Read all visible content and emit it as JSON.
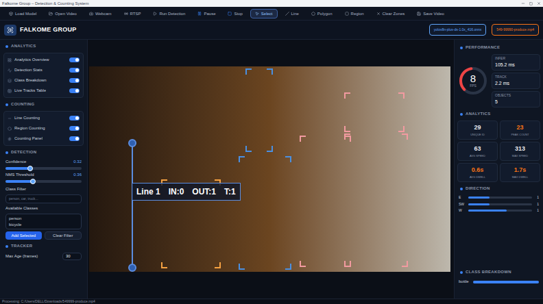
{
  "window": {
    "title": "Falkome Group – Detection & Counting System"
  },
  "toolbar": [
    {
      "label": "Load Model",
      "selected": false
    },
    {
      "label": "Open Video",
      "selected": false
    },
    {
      "label": "Webcam",
      "selected": false
    },
    {
      "label": "RTSP",
      "selected": false
    },
    {
      "label": "Run Detection",
      "selected": false
    },
    {
      "label": "Pause",
      "selected": false
    },
    {
      "label": "Stop",
      "selected": false
    },
    {
      "label": "Select",
      "selected": true
    },
    {
      "label": "Line",
      "selected": false
    },
    {
      "label": "Polygon",
      "selected": false
    },
    {
      "label": "Region",
      "selected": false
    },
    {
      "label": "Clear Zones",
      "selected": false
    },
    {
      "label": "Save Video",
      "selected": false
    }
  ],
  "header": {
    "brand": "FALKOME GROUP",
    "badges": [
      {
        "text": "yolov8n-plus-ds-1.0x_416.onnx",
        "color": "#60a5fa"
      },
      {
        "text": "549-99990-produce.mp4",
        "color": "#f97316"
      }
    ]
  },
  "sidebar": {
    "analytics": {
      "title": "ANALYTICS",
      "toggles": [
        {
          "label": "Analytics Overview",
          "on": true
        },
        {
          "label": "Detection Stats",
          "on": true
        },
        {
          "label": "Class Breakdown",
          "on": true
        },
        {
          "label": "Live Tracks Table",
          "on": true
        }
      ]
    },
    "counting": {
      "title": "COUNTING",
      "toggles": [
        {
          "label": "Line Counting",
          "on": true
        },
        {
          "label": "Region Counting",
          "on": true
        },
        {
          "label": "Counting Panel",
          "on": true
        }
      ]
    },
    "detection": {
      "title": "DETECTION",
      "sliders": [
        {
          "label": "Confidence",
          "value": "0.32",
          "level": 0.32
        },
        {
          "label": "NMS Threshold",
          "value": "0.36",
          "level": 0.36
        }
      ],
      "class_filter": {
        "label": "Class Filter",
        "placeholder": "person, car, truck..."
      },
      "available": {
        "label": "Available Classes",
        "classes": [
          "person",
          "bicycle"
        ]
      },
      "buttons": [
        {
          "label": "Add Selected",
          "primary": true
        },
        {
          "label": "Clear Filter",
          "primary": false
        }
      ]
    },
    "tracker": {
      "title": "TRACKER",
      "field": {
        "label": "Max Age (frames)",
        "value": "30"
      }
    }
  },
  "video": {
    "line": {
      "name": "Line 1",
      "in": "IN:0",
      "out": "OUT:1",
      "total": "T:1"
    },
    "detections": [
      {
        "color": "#4a90e2"
      },
      {
        "color": "#4a90e2"
      },
      {
        "color": "#f29aa0"
      },
      {
        "color": "#f29aa0"
      },
      {
        "color": "#f29aa0"
      },
      {
        "color": "#f5a142"
      }
    ]
  },
  "right": {
    "performance": {
      "title": "PERFORMANCE",
      "gauge": {
        "value": "8",
        "unit": "FPS",
        "level": 0.35
      },
      "stats": [
        {
          "label": "INFER",
          "value": "105.2 ms"
        },
        {
          "label": "TRACK",
          "value": "2.2 ms"
        },
        {
          "label": "OBJECTS",
          "value": "5"
        }
      ]
    },
    "analytics": {
      "title": "ANALYTICS",
      "cards": [
        {
          "value": "29",
          "label": "UNIQUE ID",
          "color": "#e5e7eb"
        },
        {
          "value": "23",
          "label": "PEAK COUNT",
          "color": "#f97316"
        },
        {
          "value": "63",
          "label": "AVG SPEED",
          "color": "#e5e7eb"
        },
        {
          "value": "313",
          "label": "MAX SPEED",
          "color": "#e5e7eb"
        },
        {
          "value": "0.6s",
          "label": "AVG DWELL",
          "color": "#f97316"
        },
        {
          "value": "1.7s",
          "label": "MAX DWELL",
          "color": "#f97316"
        }
      ]
    },
    "direction": {
      "title": "DIRECTION",
      "rows": [
        {
          "label": "E",
          "count": "1",
          "level": 0.33
        },
        {
          "label": "SW",
          "count": "1",
          "level": 0.33
        },
        {
          "label": "W",
          "count": "1",
          "level": 0.6
        }
      ]
    },
    "class_breakdown": {
      "title": "CLASS BREAKDOWN",
      "rows": [
        {
          "label": "bottle",
          "level": 1
        }
      ]
    }
  },
  "status_bar": {
    "text": "Processing: C:/Users/DELL/Downloads/549999-produce.mp4"
  }
}
